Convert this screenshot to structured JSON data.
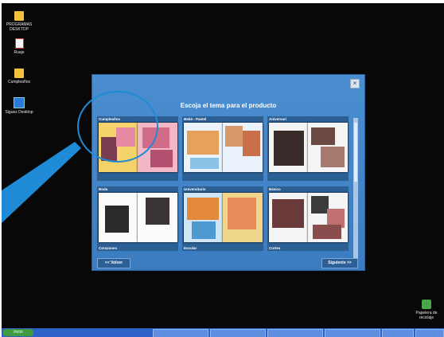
{
  "desktop": {
    "icons": [
      {
        "label": "PROGRAMAS DESKTOP",
        "icon": "folder-icon"
      },
      {
        "label": "Ruaje",
        "icon": "document-icon"
      },
      {
        "label": "Cumpleaños",
        "icon": "folder-icon"
      },
      {
        "label": "Siguez Desktop",
        "icon": "app-icon"
      },
      {
        "label": "Papelera de reciclaje",
        "icon": "recycle-bin-icon"
      }
    ]
  },
  "dialog": {
    "close": "×",
    "title": "Escoja el tema para el producto",
    "themes": [
      {
        "name": "Cumpleaños",
        "caption": ""
      },
      {
        "name": "Bebé - Pastel",
        "caption": ""
      },
      {
        "name": "Aniversari",
        "caption": ""
      },
      {
        "name": "Boda",
        "caption": "Corazones"
      },
      {
        "name": "Universitario",
        "caption": "Escolar"
      },
      {
        "name": "Básico",
        "caption": "Cortes"
      }
    ],
    "back_label": "<< Volver",
    "next_label": "Siguiente >>"
  },
  "taskbar": {
    "start_label": "Inicio",
    "tasks": [
      "",
      "",
      "",
      "",
      "",
      ""
    ]
  },
  "colors": {
    "accent": "#3b7cc0",
    "callout": "#1f8bd6"
  }
}
